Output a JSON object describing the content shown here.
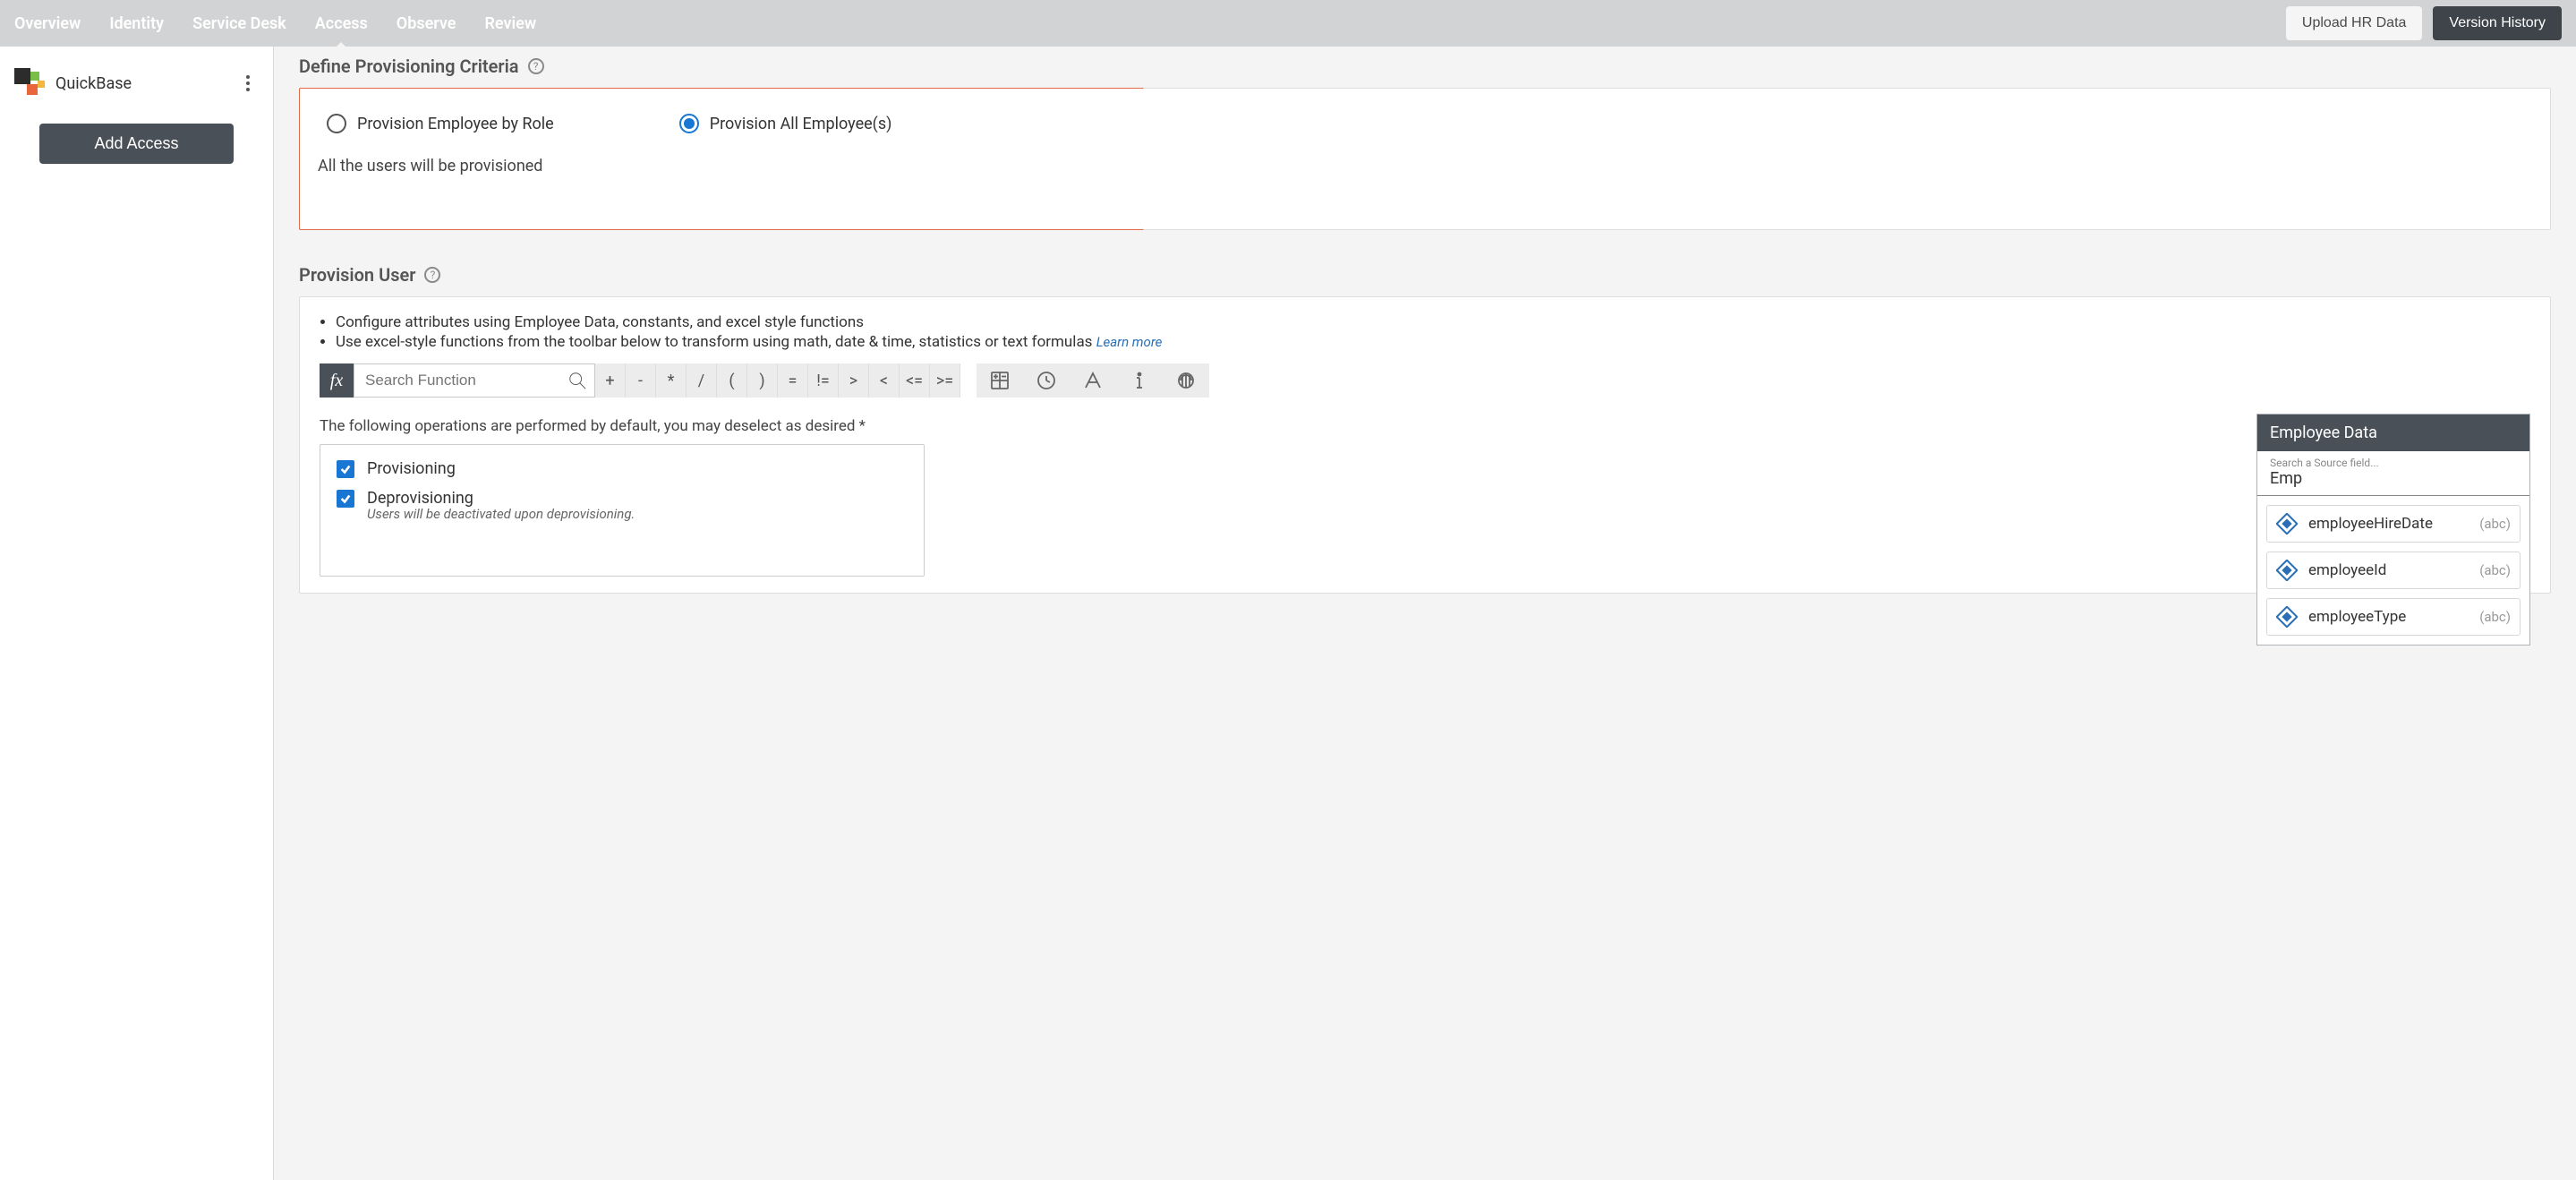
{
  "topnav": {
    "items": [
      "Overview",
      "Identity",
      "Service Desk",
      "Access",
      "Observe",
      "Review"
    ],
    "activeIndex": 3,
    "upload": "Upload HR Data",
    "history": "Version History"
  },
  "sidebar": {
    "appName": "QuickBase",
    "addAccess": "Add Access"
  },
  "criteria": {
    "title": "Define Provisioning Criteria",
    "opt_by_role": "Provision Employee by Role",
    "opt_all": "Provision All Employee(s)",
    "desc": "All the users will be provisioned"
  },
  "provisionUser": {
    "title": "Provision User",
    "bullet1": "Configure attributes using Employee Data, constants, and excel style functions",
    "bullet2": "Use excel-style functions from the toolbar below to transform using math, date & time, statistics or text formulas",
    "learnMore": "Learn more",
    "fx": "fx",
    "searchPlaceholder": "Search Function",
    "operators": [
      "+",
      "-",
      "*",
      "/",
      "(",
      ")",
      "=",
      "!=",
      ">",
      "<",
      "<=",
      ">="
    ],
    "opsNote": "The following operations are performed by default, you may deselect as desired *",
    "provisioningLabel": "Provisioning",
    "deprovisioningLabel": "Deprovisioning",
    "deprovisioningNote": "Users will be deactivated upon deprovisioning."
  },
  "employeeData": {
    "header": "Employee Data",
    "searchPlaceholder": "Search a Source field...",
    "searchValue": "Emp",
    "typeLabel": "(abc)",
    "items": [
      {
        "name": "employeeHireDate"
      },
      {
        "name": "employeeId"
      },
      {
        "name": "employeeType"
      }
    ]
  }
}
